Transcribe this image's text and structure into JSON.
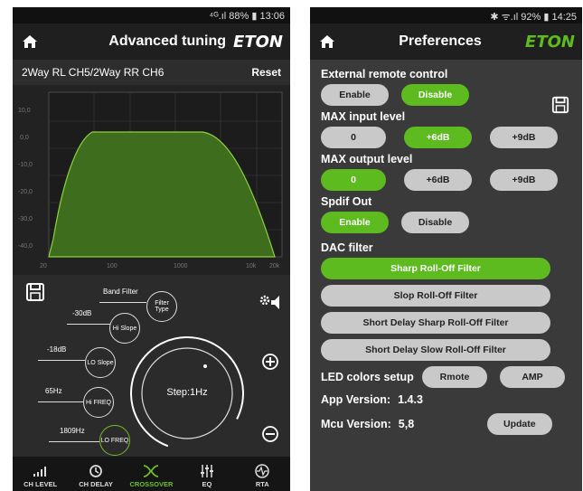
{
  "left": {
    "status": "⁴ᴳ.ıl 88% ▮ 13:06",
    "title": "Advanced tuning",
    "brand": "ETON",
    "channel": "2Way RL CH5/2Way RR CH6",
    "reset": "Reset",
    "graph": {
      "y_ticks": [
        "10,0",
        "0,0",
        "-10,0",
        "-20,0",
        "-30,0",
        "-40,0"
      ],
      "x_ticks": [
        "20",
        "100",
        "1000",
        "10k",
        "20k"
      ]
    },
    "controls": {
      "filter_type": {
        "label": "Band Filter",
        "button": "Filter Type"
      },
      "hi_slope": {
        "label": "-30dB",
        "button": "Hi Slope"
      },
      "lo_slope": {
        "label": "-18dB",
        "button": "LO Slope"
      },
      "hi_freq": {
        "label": "65Hz",
        "button": "Hi FREQ"
      },
      "lo_freq": {
        "label": "1809Hz",
        "button": "LO FREQ"
      },
      "dial": "Step:1Hz"
    },
    "nav": [
      {
        "label": "CH LEVEL",
        "icon": "bars-icon"
      },
      {
        "label": "CH DELAY",
        "icon": "clock-icon"
      },
      {
        "label": "CROSSOVER",
        "icon": "crossover-icon",
        "active": true
      },
      {
        "label": "EQ",
        "icon": "sliders-icon"
      },
      {
        "label": "RTA",
        "icon": "pulse-icon"
      }
    ],
    "accent": "#6fbf2a"
  },
  "right": {
    "status": "✱ ᯤ.ıl 92% ▮ 14:25",
    "title": "Preferences",
    "brand": "ETON",
    "external_remote": {
      "title": "External remote control",
      "enable": "Enable",
      "disable": "Disable"
    },
    "max_input": {
      "title": "MAX input level",
      "options": [
        "0",
        "+6dB",
        "+9dB"
      ]
    },
    "max_output": {
      "title": "MAX output level",
      "options": [
        "0",
        "+6dB",
        "+9dB"
      ]
    },
    "spdif": {
      "title": "Spdif Out",
      "enable": "Enable",
      "disable": "Disable"
    },
    "dac": {
      "title": "DAC filter",
      "options": [
        "Sharp Roll-Off Filter",
        "Slop Roll-Off Filter",
        "Short Delay Sharp Roll-Off Filter",
        "Short Delay Slow Roll-Off Filter"
      ]
    },
    "led": {
      "title": "LED colors setup",
      "rmote": "Rmote",
      "amp": "AMP"
    },
    "app_version": {
      "label": "App Version:",
      "value": "1.4.3"
    },
    "mcu_version": {
      "label": "Mcu Version:",
      "value": "5,8"
    },
    "update": "Update",
    "accent": "#5dba1f"
  }
}
